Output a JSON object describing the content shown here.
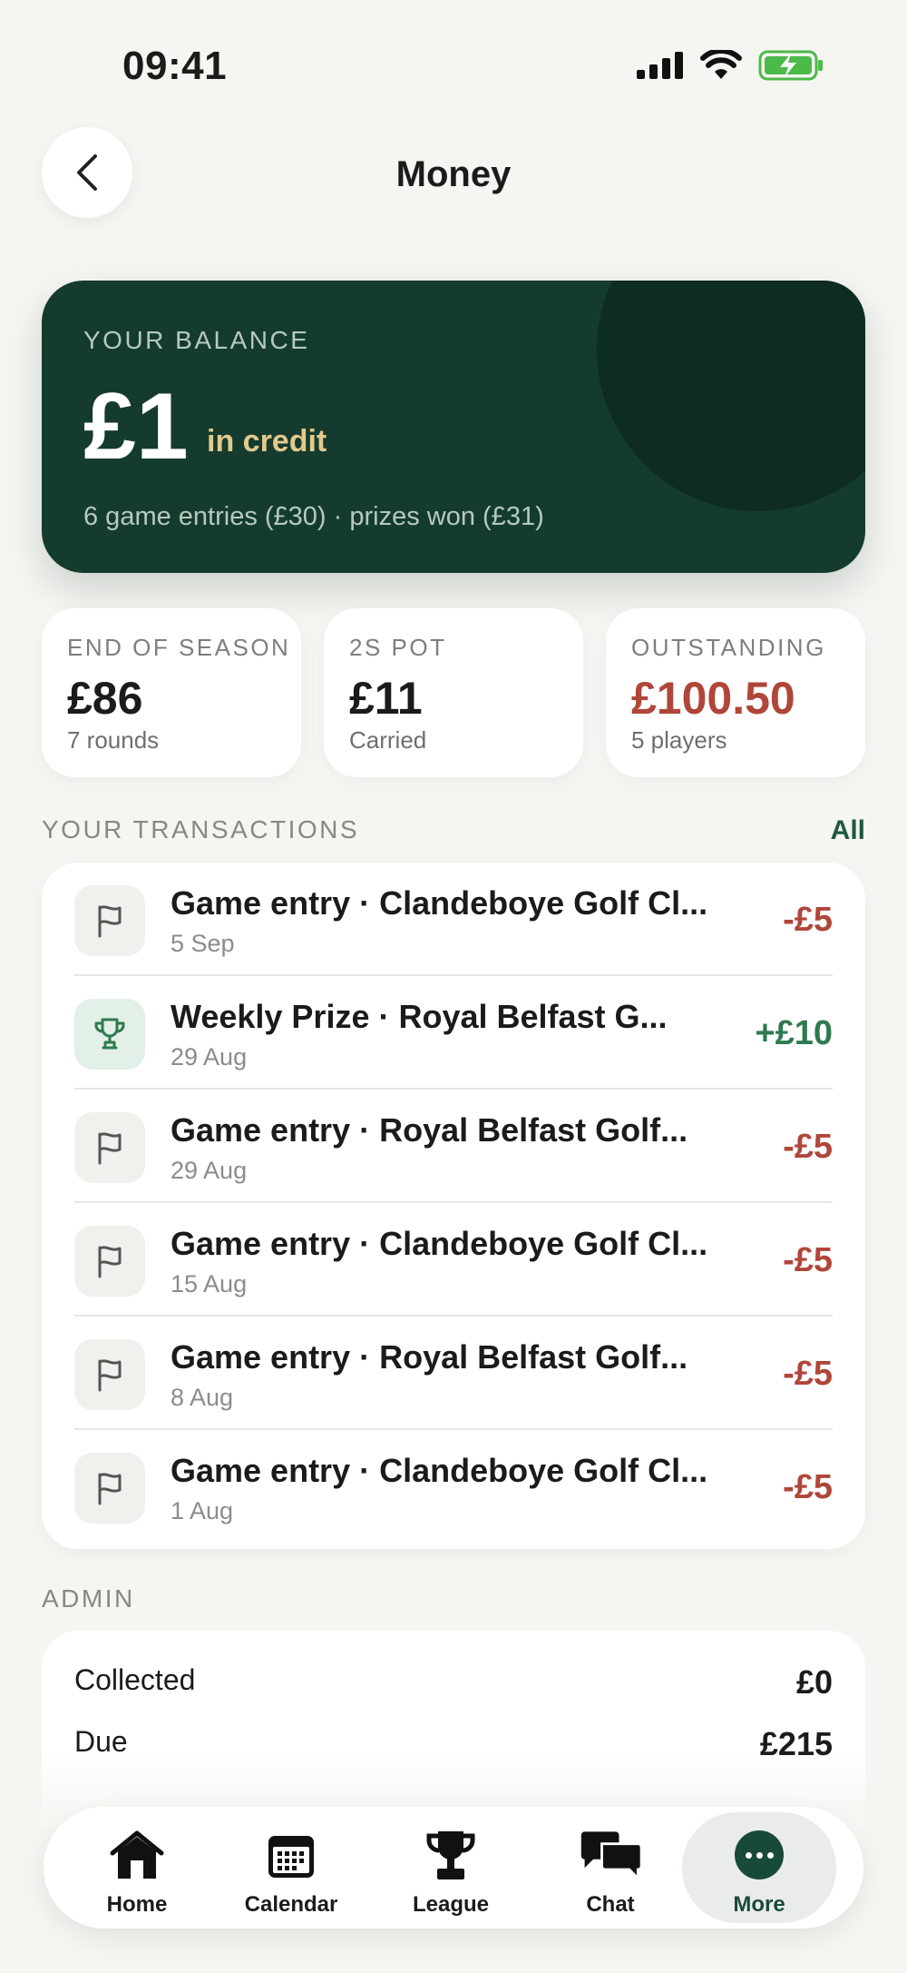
{
  "status_bar": {
    "time": "09:41"
  },
  "header": {
    "title": "Money"
  },
  "balance": {
    "label": "YOUR BALANCE",
    "amount": "£1",
    "status": "in credit",
    "detail": "6 game entries (£30) · prizes won (£31)"
  },
  "stats": [
    {
      "label": "END OF SEASON",
      "value": "£86",
      "sub": "7 rounds",
      "color": "#1b1b1b"
    },
    {
      "label": "2S POT",
      "value": "£11",
      "sub": "Carried",
      "color": "#1b1b1b"
    },
    {
      "label": "OUTSTANDING",
      "value": "£100.50",
      "sub": "5 players",
      "color": "#b0463a"
    }
  ],
  "transactions_section": {
    "label": "YOUR TRANSACTIONS",
    "all_link": "All",
    "items": [
      {
        "icon": "flag-icon",
        "title": "Game entry · Clandeboye Golf Cl...",
        "date": "5 Sep",
        "amount": "-£5"
      },
      {
        "icon": "trophy-icon",
        "title": "Weekly Prize · Royal Belfast G...",
        "date": "29 Aug",
        "amount": "+£10"
      },
      {
        "icon": "flag-icon",
        "title": "Game entry · Royal Belfast Golf...",
        "date": "29 Aug",
        "amount": "-£5"
      },
      {
        "icon": "flag-icon",
        "title": "Game entry · Clandeboye Golf Cl...",
        "date": "15 Aug",
        "amount": "-£5"
      },
      {
        "icon": "flag-icon",
        "title": "Game entry · Royal Belfast Golf...",
        "date": "8 Aug",
        "amount": "-£5"
      },
      {
        "icon": "flag-icon",
        "title": "Game entry · Clandeboye Golf Cl...",
        "date": "1 Aug",
        "amount": "-£5"
      }
    ]
  },
  "admin": {
    "label": "ADMIN",
    "rows": [
      {
        "label": "Collected",
        "value": "£0"
      },
      {
        "label": "Due",
        "value": "£215"
      }
    ]
  },
  "tab_bar": {
    "tabs": [
      {
        "label": "Home",
        "icon": "home-icon"
      },
      {
        "label": "Calendar",
        "icon": "calendar-icon"
      },
      {
        "label": "League",
        "icon": "trophy-icon"
      },
      {
        "label": "Chat",
        "icon": "chat-icon"
      },
      {
        "label": "More",
        "icon": "more-icon",
        "active": true
      }
    ]
  },
  "colors": {
    "brand_green": "#143b2e",
    "negative": "#b0463a",
    "positive": "#2e7a4f",
    "gold": "#e2c98c"
  }
}
